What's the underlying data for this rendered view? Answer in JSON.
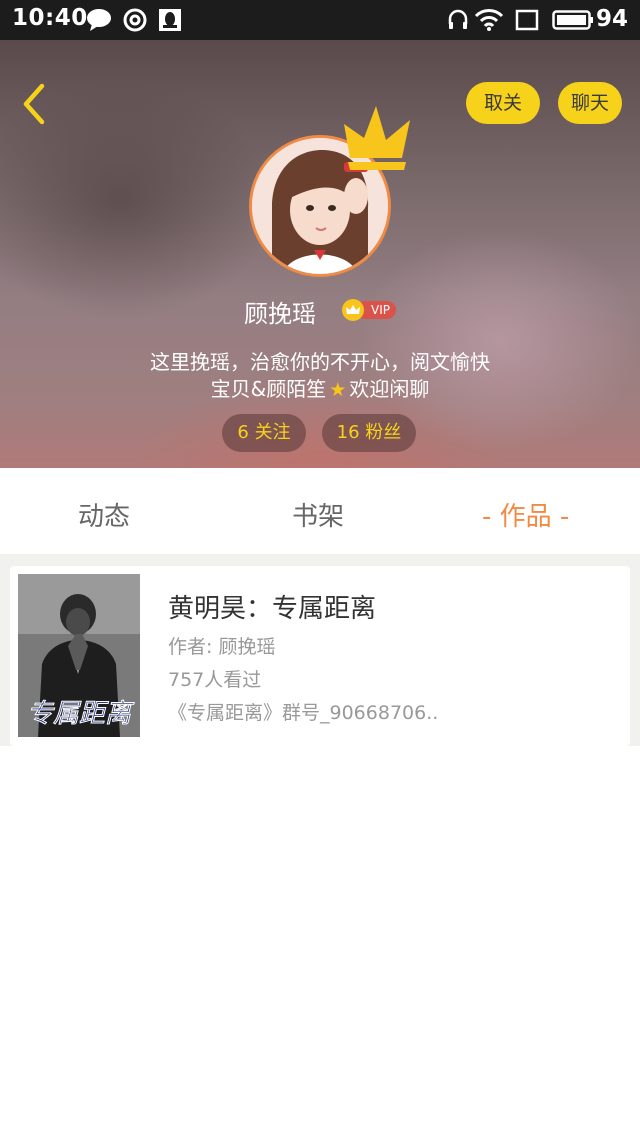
{
  "status_bar": {
    "time": "10:40",
    "battery": "94",
    "icons": [
      "chat-bubble-icon",
      "netease-music-icon",
      "qq-icon",
      "headset-icon",
      "wifi-icon",
      "screen-icon",
      "battery-icon"
    ]
  },
  "header": {
    "back_icon": "chevron-left-icon",
    "unfollow_label": "取关",
    "chat_label": "聊天",
    "username": "顾挽瑶",
    "vip_label": "VIP",
    "bio_line1": "这里挽瑶，治愈你的不开心，阅文愉快",
    "bio_line2_before": "宝贝&顾陌笙",
    "bio_line2_after": "欢迎闲聊",
    "following": "6 关注",
    "fans": "16 粉丝"
  },
  "tabs": [
    {
      "label": "动态"
    },
    {
      "label": "书架"
    },
    {
      "label": "- 作品 -"
    }
  ],
  "books": [
    {
      "title": "黄明昊：专属距离",
      "author": "作者: 顾挽瑶",
      "views": "757人看过",
      "desc": "《专属距离》群号_90668706..",
      "cover_text": "专属距离"
    }
  ],
  "colors": {
    "accent": "#f7d21b",
    "active_tab": "#f08a44",
    "vip_red": "#d9534a"
  }
}
